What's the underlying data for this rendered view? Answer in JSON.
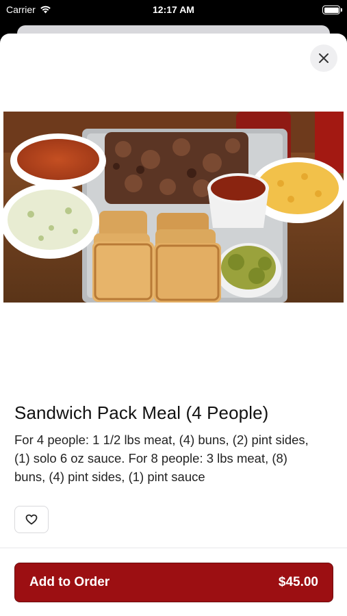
{
  "status_bar": {
    "carrier": "Carrier",
    "time": "12:17 AM",
    "wifi_icon": "wifi-icon",
    "battery_icon": "battery-icon"
  },
  "item": {
    "title": "Sandwich Pack Meal (4 People)",
    "description": "For 4 people: 1 1/2 lbs meat, (4) buns, (2) pint sides, (1) solo 6 oz sauce. For 8 people: 3 lbs meat, (8) buns, (4) pint sides, (1) pint sauce"
  },
  "actions": {
    "close_icon": "close-icon",
    "favorite_icon": "heart-icon",
    "add_label": "Add to Order",
    "price": "$45.00"
  },
  "colors": {
    "accent": "#9c0f12",
    "background": "#ffffff"
  }
}
